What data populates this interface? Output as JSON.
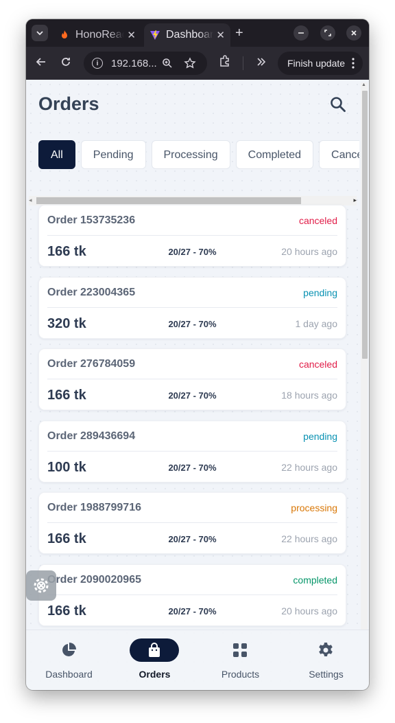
{
  "browser": {
    "tabs": [
      {
        "title": "HonoReact",
        "favicon": "fire-icon",
        "active": false
      },
      {
        "title": "Dashboard",
        "favicon": "vite-icon",
        "active": true
      }
    ],
    "address": "192.168...",
    "finish_update_label": "Finish update"
  },
  "page": {
    "title": "Orders",
    "filters": [
      "All",
      "Pending",
      "Processing",
      "Completed",
      "Canceled"
    ],
    "active_filter": "All",
    "orders": [
      {
        "id": "Order 153735236",
        "status": "canceled",
        "amount": "166 tk",
        "progress": "20/27 - 70%",
        "time": "20 hours ago"
      },
      {
        "id": "Order 223004365",
        "status": "pending",
        "amount": "320 tk",
        "progress": "20/27 - 70%",
        "time": "1 day ago"
      },
      {
        "id": "Order 276784059",
        "status": "canceled",
        "amount": "166 tk",
        "progress": "20/27 - 70%",
        "time": "18 hours ago"
      },
      {
        "id": "Order 289436694",
        "status": "pending",
        "amount": "100 tk",
        "progress": "20/27 - 70%",
        "time": "22 hours ago"
      },
      {
        "id": "Order 1988799716",
        "status": "processing",
        "amount": "166 tk",
        "progress": "20/27 - 70%",
        "time": "22 hours ago"
      },
      {
        "id": "Order 2090020965",
        "status": "completed",
        "amount": "166 tk",
        "progress": "20/27 - 70%",
        "time": "20 hours ago"
      }
    ],
    "status_colors": {
      "canceled": "#e11d48",
      "pending": "#0891b2",
      "processing": "#d97706",
      "completed": "#059669"
    }
  },
  "bottom_nav": [
    {
      "label": "Dashboard",
      "icon": "pie-chart-icon",
      "active": false
    },
    {
      "label": "Orders",
      "icon": "shopping-bag-icon",
      "active": true
    },
    {
      "label": "Products",
      "icon": "grid-icon",
      "active": false
    },
    {
      "label": "Settings",
      "icon": "gear-icon",
      "active": false
    }
  ]
}
